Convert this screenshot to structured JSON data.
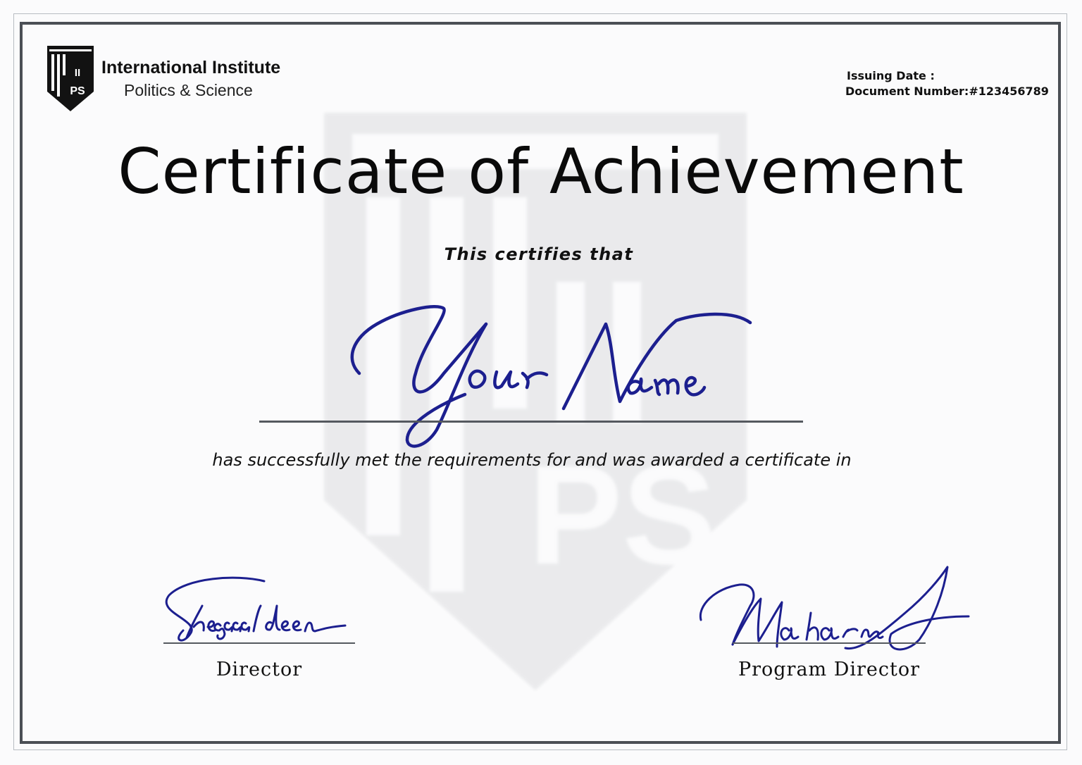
{
  "organization": {
    "name": "International Institute",
    "subtitle": "Politics & Science",
    "logo_letters_top": "II",
    "logo_letters_bottom": "PS"
  },
  "meta": {
    "issuing_date_label": "Issuing Date :",
    "document_number_label": "Document Number:#123456789"
  },
  "certificate": {
    "title": "Certificate of Achievement",
    "certifies_text": "This certifies that",
    "recipient_name": "Your Name",
    "awarded_text": "has successfully met the requirements for and was awarded a certificate in"
  },
  "signatories": [
    {
      "signature": "Shegaaaldeen",
      "role": "Director"
    },
    {
      "signature": "Maharm A",
      "role": "Program Director"
    }
  ],
  "colors": {
    "signature_ink": "#1c1f8f",
    "frame": "#4b4f55",
    "text": "#111111"
  }
}
